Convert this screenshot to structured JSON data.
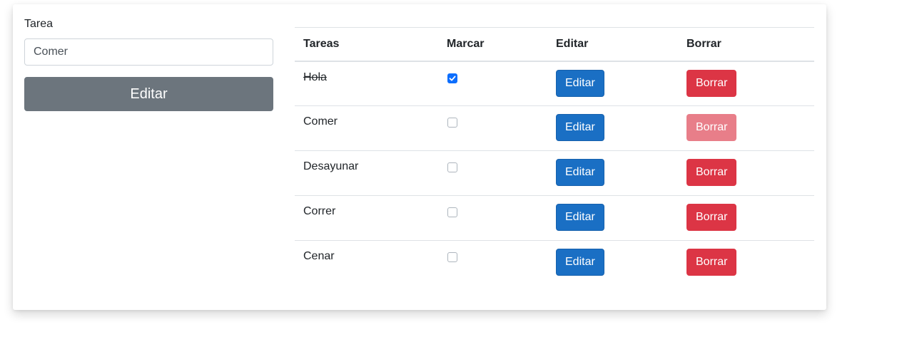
{
  "form": {
    "label": "Tarea",
    "input_value": "Comer",
    "submit_label": "Editar"
  },
  "table": {
    "headers": {
      "task": "Tareas",
      "check": "Marcar",
      "edit": "Editar",
      "delete": "Borrar"
    },
    "rows": [
      {
        "task": "Hola",
        "checked": true,
        "edit_label": "Editar",
        "delete_label": "Borrar",
        "delete_disabled": false
      },
      {
        "task": "Comer",
        "checked": false,
        "edit_label": "Editar",
        "delete_label": "Borrar",
        "delete_disabled": true
      },
      {
        "task": "Desayunar",
        "checked": false,
        "edit_label": "Editar",
        "delete_label": "Borrar",
        "delete_disabled": false
      },
      {
        "task": "Correr",
        "checked": false,
        "edit_label": "Editar",
        "delete_label": "Borrar",
        "delete_disabled": false
      },
      {
        "task": "Cenar",
        "checked": false,
        "edit_label": "Editar",
        "delete_label": "Borrar",
        "delete_disabled": false
      }
    ]
  },
  "colors": {
    "primary": "#1a6fc4",
    "danger": "#dc3545",
    "danger_disabled": "#e87e89",
    "secondary": "#6c757d",
    "checkbox_checked": "#0d6efd"
  },
  "icons": {
    "checkmark": "check-icon"
  }
}
